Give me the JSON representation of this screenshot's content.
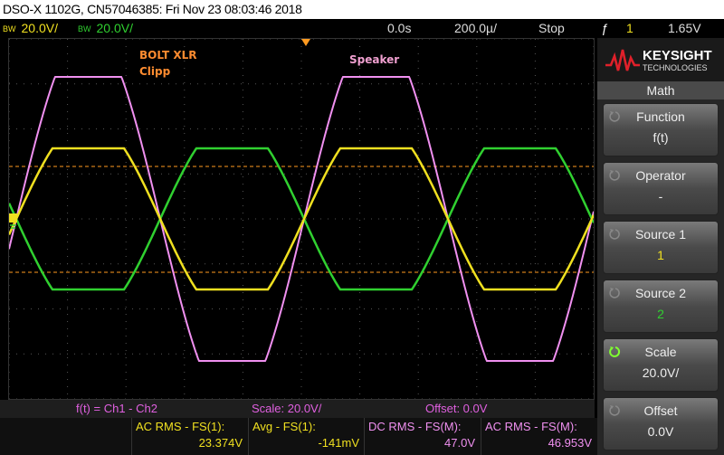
{
  "title_bar": "DSO-X 1102G, CN57046385: Fri Nov 23 08:03:46 2018",
  "status": {
    "ch1_bw": "BW",
    "ch1_scale": "20.0V/",
    "ch2_bw": "BW",
    "ch2_scale": "20.0V/",
    "time_delay": "0.0s",
    "time_scale": "200.0µ/",
    "run_state": "Stop",
    "trigger_symbol": "ƒ",
    "trigger_source": "1",
    "trigger_level": "1.65V"
  },
  "annotations": {
    "bolt_line1": "BOLT XLR",
    "bolt_line2": "Clipp",
    "speaker": "Speaker"
  },
  "brand": {
    "name": "KEYSIGHT",
    "sub": "TECHNOLOGIES"
  },
  "menu": {
    "title": "Math",
    "keys": [
      {
        "label": "Function",
        "value": "f(t)"
      },
      {
        "label": "Operator",
        "value": "-"
      },
      {
        "label": "Source 1",
        "value": "1"
      },
      {
        "label": "Source 2",
        "value": "2"
      },
      {
        "label": "Scale",
        "value": "20.0V/"
      },
      {
        "label": "Offset",
        "value": "0.0V"
      }
    ]
  },
  "math_bar": {
    "function": "f(t) = Ch1 - Ch2",
    "scale": "Scale: 20.0V/",
    "offset": "Offset: 0.0V"
  },
  "measurements": [
    {
      "label": "AC RMS - FS(1):",
      "value": "23.374V"
    },
    {
      "label": "Avg - FS(1):",
      "value": "-141mV"
    },
    {
      "label": "DC RMS - FS(M):",
      "value": "47.0V"
    },
    {
      "label": "AC RMS - FS(M):",
      "value": "46.953V"
    }
  ],
  "colors": {
    "ch1": "#f0e020",
    "ch2": "#30d030",
    "math": "#f090f0",
    "cursor": "#ff9a20",
    "annotation_bolt": "#ff8c30",
    "annotation_speaker": "#f0a0d0",
    "source1_value": "#f0e020",
    "source2_value": "#30d030",
    "scale_icon": "#80ff30"
  },
  "icons": {
    "trigger_marker": "triangle-down-icon",
    "ground_marker": "ground-icon",
    "logo": "keysight-wave-icon",
    "softkey_rotate": "rotate-knob-icon"
  }
}
